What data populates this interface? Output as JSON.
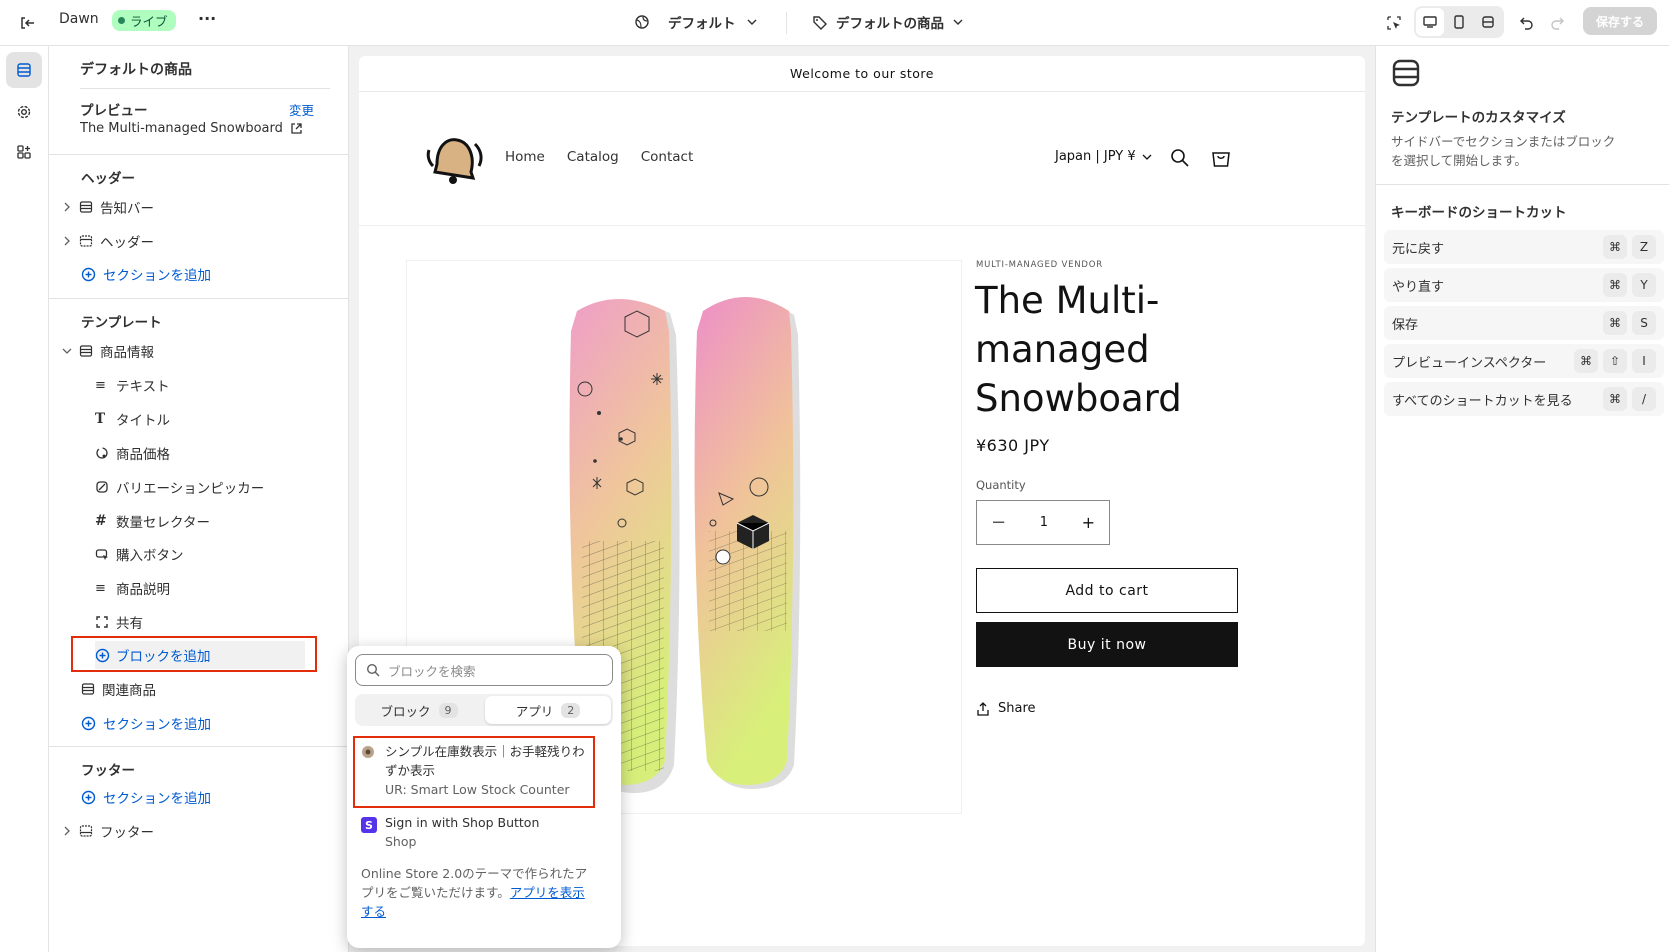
{
  "topbar": {
    "theme_name": "Dawn",
    "live_badge": "ライブ",
    "more": "···",
    "theme_select": "デフォルト",
    "template_select": "デフォルトの商品",
    "save_label": "保存する"
  },
  "sidebar": {
    "title": "デフォルトの商品",
    "preview_label": "プレビュー",
    "preview_change": "変更",
    "preview_product": "The Multi-managed Snowboard",
    "header_section": "ヘッダー",
    "header_items": [
      "告知バー",
      "ヘッダー"
    ],
    "add_section": "セクションを追加",
    "template_section": "テンプレート",
    "product_info": "商品情報",
    "blocks": [
      "テキスト",
      "タイトル",
      "商品価格",
      "バリエーションピッカー",
      "数量セレクター",
      "購入ボタン",
      "商品説明",
      "共有"
    ],
    "add_block": "ブロックを追加",
    "related_products": "関連商品",
    "footer_section": "フッター",
    "footer_item": "フッター"
  },
  "store": {
    "announcement": "Welcome to our store",
    "nav": [
      "Home",
      "Catalog",
      "Contact"
    ],
    "currency": "Japan | JPY ¥",
    "vendor": "MULTI-MANAGED VENDOR",
    "product_title_lines": [
      "The Multi-",
      "managed",
      "Snowboard"
    ],
    "price": "¥630 JPY",
    "quantity_label": "Quantity",
    "quantity_value": "1",
    "add_to_cart": "Add to cart",
    "buy_now": "Buy it now",
    "share": "Share"
  },
  "popup": {
    "search_placeholder": "ブロックを検索",
    "tab_blocks": "ブロック",
    "tab_blocks_count": "9",
    "tab_apps": "アプリ",
    "tab_apps_count": "2",
    "app1_title_line1": "シンプル在庫数表示｜お手軽残りわ",
    "app1_title_line2": "ずか表示",
    "app1_sub": "UR: Smart Low Stock Counter",
    "app2_title": "Sign in with Shop Button",
    "app2_sub": "Shop",
    "info_line1": "Online Store 2.0のテーマで作られたア",
    "info_line2_pre": "プリをご覧いただけます。",
    "info_link1": "アプリを表示",
    "info_link2": "する"
  },
  "right_panel": {
    "title": "テンプレートのカスタマイズ",
    "desc_line1": "サイドバーでセクションまたはブロック",
    "desc_line2": "を選択して開始します。",
    "shortcuts_title": "キーボードのショートカット",
    "shortcuts": [
      {
        "label": "元に戻す",
        "keys": [
          "⌘",
          "Z"
        ]
      },
      {
        "label": "やり直す",
        "keys": [
          "⌘",
          "Y"
        ]
      },
      {
        "label": "保存",
        "keys": [
          "⌘",
          "S"
        ]
      },
      {
        "label": "プレビューインスペクター",
        "keys": [
          "⌘",
          "⇧",
          "I"
        ]
      },
      {
        "label": "すべてのショートカットを見る",
        "keys": [
          "⌘",
          "/"
        ]
      }
    ]
  },
  "colors": {
    "accent": "#005bd3",
    "live": "#affebf",
    "highlight": "#e22c0c"
  }
}
